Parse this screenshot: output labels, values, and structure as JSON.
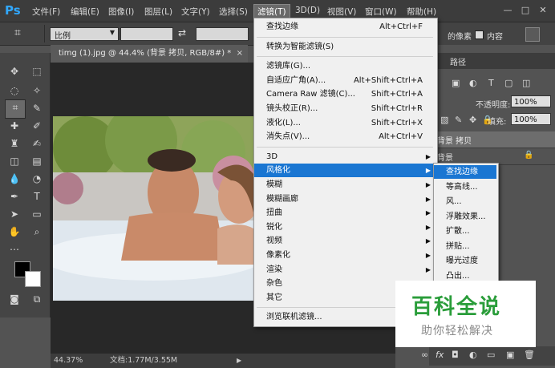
{
  "app": {
    "logo": "Ps"
  },
  "menubar": {
    "items": [
      "文件(F)",
      "编辑(E)",
      "图像(I)",
      "图层(L)",
      "文字(Y)",
      "选择(S)",
      "滤镜(T)",
      "3D(D)",
      "视图(V)",
      "窗口(W)",
      "帮助(H)"
    ],
    "window_controls": [
      "—",
      "□",
      "✕"
    ]
  },
  "options_bar": {
    "ratio_label": "比例",
    "swap_icon": "⇄",
    "right_text": "的像素",
    "content_aware": "内容",
    "checkbox_checked": false
  },
  "document": {
    "tab_title": "timg (1).jpg @ 44.4% (背景 拷贝, RGB/8#) *",
    "close": "×"
  },
  "status": {
    "zoom": "44.37%",
    "doc_info": "文档:1.77M/3.55M"
  },
  "filter_menu": {
    "items": [
      {
        "label": "查找边缘",
        "shortcut": "Alt+Ctrl+F"
      },
      {
        "sep": true
      },
      {
        "label": "转换为智能滤镜(S)"
      },
      {
        "sep": true
      },
      {
        "label": "滤镜库(G)..."
      },
      {
        "label": "自适应广角(A)...",
        "shortcut": "Alt+Shift+Ctrl+A"
      },
      {
        "label": "Camera Raw 滤镜(C)...",
        "shortcut": "Shift+Ctrl+A"
      },
      {
        "label": "镜头校正(R)...",
        "shortcut": "Shift+Ctrl+R"
      },
      {
        "label": "液化(L)...",
        "shortcut": "Shift+Ctrl+X"
      },
      {
        "label": "消失点(V)...",
        "shortcut": "Alt+Ctrl+V"
      },
      {
        "sep": true
      },
      {
        "label": "3D",
        "submenu": true
      },
      {
        "label": "风格化",
        "submenu": true,
        "highlight": true
      },
      {
        "label": "模糊",
        "submenu": true
      },
      {
        "label": "模糊画廊",
        "submenu": true
      },
      {
        "label": "扭曲",
        "submenu": true
      },
      {
        "label": "锐化",
        "submenu": true
      },
      {
        "label": "视频",
        "submenu": true
      },
      {
        "label": "像素化",
        "submenu": true
      },
      {
        "label": "渲染",
        "submenu": true
      },
      {
        "label": "杂色",
        "submenu": true
      },
      {
        "label": "其它",
        "submenu": true
      },
      {
        "sep": true
      },
      {
        "label": "浏览联机滤镜..."
      }
    ]
  },
  "stylize_submenu": {
    "items": [
      {
        "label": "查找边缘",
        "highlight": true
      },
      {
        "label": "等高线..."
      },
      {
        "label": "风..."
      },
      {
        "label": "浮雕效果..."
      },
      {
        "label": "扩散..."
      },
      {
        "label": "拼贴..."
      },
      {
        "label": "曝光过度"
      },
      {
        "label": "凸出..."
      }
    ]
  },
  "layers_panel": {
    "tab": "路径",
    "opacity_label": "不透明度:",
    "opacity_value": "100%",
    "fill_label": "填充:",
    "fill_value": "100%",
    "layers": [
      {
        "name": "背景 拷贝",
        "selected": true
      },
      {
        "name": "背景",
        "locked": true
      }
    ],
    "footer_icons": [
      "∞",
      "fx",
      "◘",
      "◐",
      "▭",
      "▣",
      "🗑"
    ]
  },
  "watermark": {
    "title": "百科全说",
    "subtitle": "助你轻松解决"
  },
  "colors": {
    "accent": "#1a76d2",
    "panel": "#535353",
    "menu_bg": "#f0f0f0",
    "watermark_title": "#2a9d3a"
  }
}
